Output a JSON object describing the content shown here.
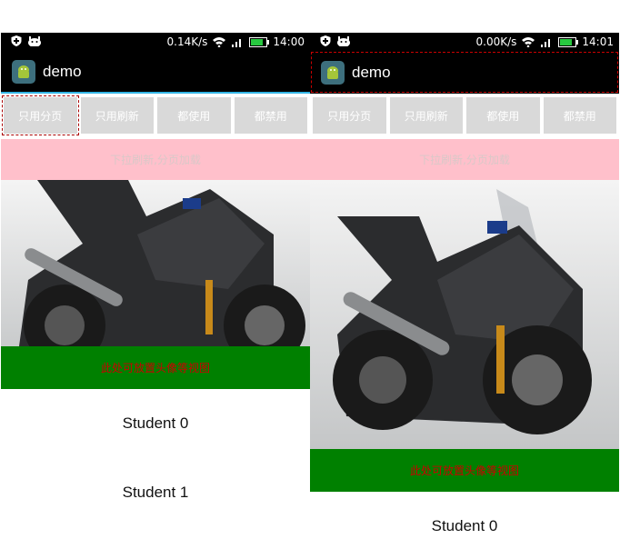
{
  "phones": [
    {
      "status": {
        "speed": "0.14K/s",
        "time": "14:00"
      },
      "app_title": "demo",
      "buttons": [
        "只用分页",
        "只用刷新",
        "都使用",
        "都禁用"
      ],
      "pull_hint": "下拉刷新,分页加载",
      "header_hint": "此处可放置头像等视图",
      "students": [
        "Student 0",
        "Student 1"
      ]
    },
    {
      "status": {
        "speed": "0.00K/s",
        "time": "14:01"
      },
      "app_title": "demo",
      "buttons": [
        "只用分页",
        "只用刷新",
        "都使用",
        "都禁用"
      ],
      "pull_hint": "下拉刷新,分页加载",
      "header_hint": "此处可放置头像等视图",
      "students": [
        "Student 0"
      ]
    }
  ],
  "colors": {
    "status_bar": "#000000",
    "pull_bar": "#ffc0cb",
    "header_bar": "#008000",
    "header_text": "#cc0000",
    "button_bg": "#d9d9d9",
    "accent_line": "#33b5e5"
  },
  "icons": [
    "shield-icon",
    "android-icon",
    "wifi-icon",
    "signal-icon",
    "battery-icon",
    "app-launcher-icon",
    "motorcycle-image"
  ]
}
